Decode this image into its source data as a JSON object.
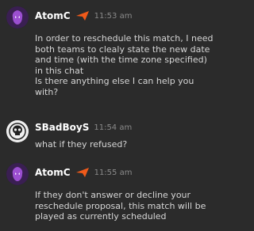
{
  "messages": [
    {
      "author": "AtomC",
      "time": "11:53 am",
      "paragraphs": [
        "In order to reschedule this match, I need both teams to clealy state the new date and time (with the time zone specified) in this chat",
        "Is there anything else I can help you with?"
      ]
    },
    {
      "author": "SBadBoyS",
      "time": "11:54 am",
      "paragraphs": [
        "what if they refused?"
      ]
    },
    {
      "author": "AtomC",
      "time": "11:55 am",
      "paragraphs": [
        "If they don't answer or decline your reschedule proposal, this match will be played as currently scheduled"
      ]
    }
  ],
  "colors": {
    "background": "#2b2b2b",
    "name": "#ffffff",
    "badge": "#f05a1a",
    "time": "#8a8a8a"
  }
}
